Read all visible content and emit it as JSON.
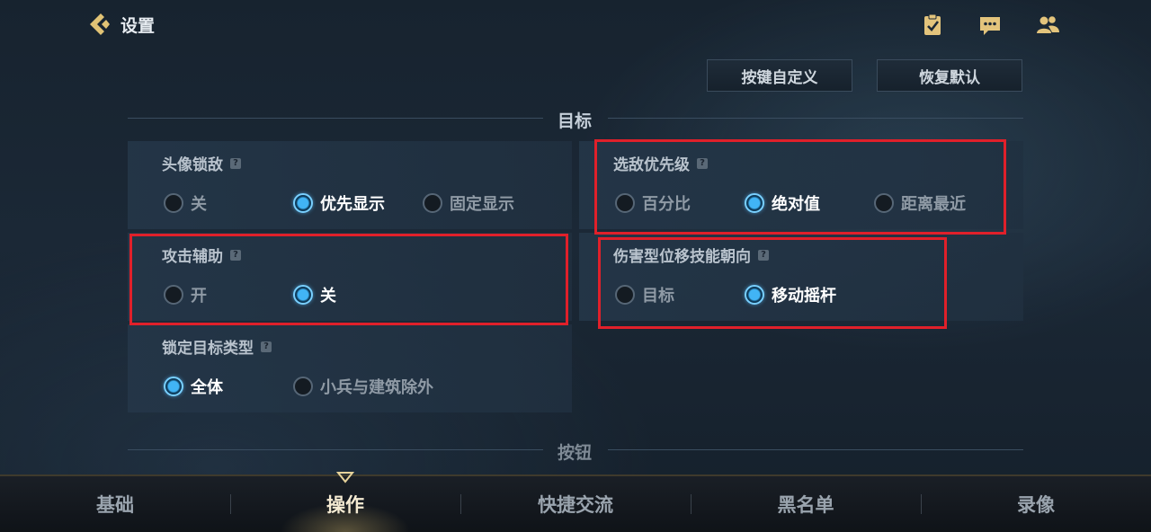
{
  "header": {
    "title": "设置"
  },
  "toolbar": {
    "customize_keys": "按键自定义",
    "restore_default": "恢复默认"
  },
  "sections": {
    "target": "目标",
    "buttons": "按钮"
  },
  "panels": {
    "lock_by_avatar": {
      "label": "头像锁敌",
      "options": [
        "关",
        "优先显示",
        "固定显示"
      ],
      "selected": 1
    },
    "enemy_priority": {
      "label": "选敌优先级",
      "options": [
        "百分比",
        "绝对值",
        "距离最近"
      ],
      "selected": 1
    },
    "attack_assist": {
      "label": "攻击辅助",
      "options": [
        "开",
        "关"
      ],
      "selected": 1
    },
    "dash_direction": {
      "label": "伤害型位移技能朝向",
      "options": [
        "目标",
        "移动摇杆"
      ],
      "selected": 1
    },
    "lock_target_type": {
      "label": "锁定目标类型",
      "options": [
        "全体",
        "小兵与建筑除外"
      ],
      "selected": 0
    }
  },
  "nav": {
    "items": [
      "基础",
      "操作",
      "快捷交流",
      "黑名单",
      "录像"
    ],
    "active": 1
  },
  "colors": {
    "accent": "#41b4f5",
    "highlight": "#e0202a",
    "gold": "#e6c878"
  }
}
